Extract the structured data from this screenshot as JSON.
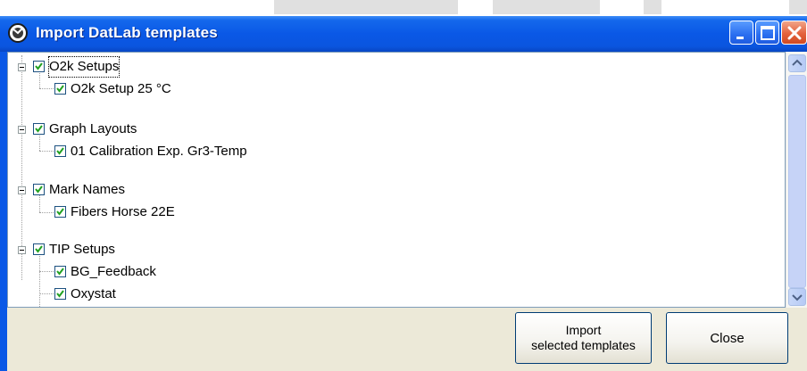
{
  "window": {
    "title": "Import DatLab templates"
  },
  "tree": {
    "groups": [
      {
        "label": "O2k Setups",
        "checked": true,
        "expanded": true,
        "items": [
          {
            "label": "O2k Setup 25 °C",
            "checked": true
          }
        ]
      },
      {
        "label": "Graph Layouts",
        "checked": true,
        "expanded": true,
        "items": [
          {
            "label": "01 Calibration Exp. Gr3-Temp",
            "checked": true
          }
        ]
      },
      {
        "label": "Mark Names",
        "checked": true,
        "expanded": true,
        "items": [
          {
            "label": "Fibers Horse 22E",
            "checked": true
          }
        ]
      },
      {
        "label": "TIP Setups",
        "checked": true,
        "expanded": true,
        "items": [
          {
            "label": "BG_Feedback",
            "checked": true
          },
          {
            "label": "Oxystat",
            "checked": true
          }
        ]
      }
    ]
  },
  "buttons": {
    "import_line1": "Import",
    "import_line2": "selected templates",
    "close": "Close"
  },
  "colors": {
    "titlebar": "#0a58e6",
    "dialog_face": "#ece9d8",
    "close_button": "#e4623c"
  },
  "icons": {
    "app": "datlab-app-icon",
    "minimize": "minimize-icon",
    "maximize": "maximize-icon",
    "close": "close-icon",
    "scroll_up": "scroll-up-arrow-icon",
    "scroll_down": "scroll-down-arrow-icon"
  }
}
